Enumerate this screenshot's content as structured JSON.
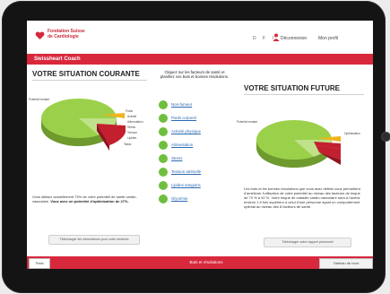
{
  "header": {
    "logo_lines": [
      "Fondation Suisse",
      "de Cardiologie"
    ],
    "lang_links": "D F I",
    "user_link": "Déconnexion",
    "profile_link": "Mon profil"
  },
  "brand_bar": {
    "title": "Swissheart Coach"
  },
  "left_panel": {
    "title": "VOTRE SITUATION COURANTE",
    "pie_labels": [
      "Potentiel restant",
      "Poids",
      "Activité",
      "Alimentation",
      "Stress",
      "Tension",
      "Lipides",
      "Tabac"
    ],
    "text": "Vous utilisez actuellement 73% de votre potentiel de santé cardio-vasculaire.",
    "text_bold": "Vous avez un potentiel d'optimisation de 27%.",
    "button": "Télécharger les informations pour votre médecin"
  },
  "middle_panel": {
    "intro": "Cliquez sur les facteurs de santé et planifiez vos buts et bonnes résolutions.",
    "factors": [
      {
        "label": "Non-fumeur",
        "color": "green"
      },
      {
        "label": "Poids corporel",
        "color": "green"
      },
      {
        "label": "Activité physique",
        "color": "green"
      },
      {
        "label": "Alimentation",
        "color": "green"
      },
      {
        "label": "Stress",
        "color": "green"
      },
      {
        "label": "Tension artérielle",
        "color": "green"
      },
      {
        "label": "Lipides sanguins",
        "color": "green"
      },
      {
        "label": "Glycémie",
        "color": "green"
      }
    ]
  },
  "right_panel": {
    "title": "VOTRE SITUATION FUTURE",
    "pie_labels": [
      "Potentiel restant",
      "Optimisation"
    ],
    "text": "Les buts et les bonnes résolutions que vous avez définis vous permettent d'améliorer l'utilisation de votre potentiel au niveau des facteurs de risque de 73 % à 92 %. Votre risque de maladie cardio-vasculaire sera à l'avenir environ 1.5 fois supérieur à celui d'une personne ayant un comportement optimal au niveau des 8 facteurs de santé.",
    "button": "Télécharger votre rapport personnel"
  },
  "footer": {
    "left_tab": "Tests",
    "center": "Buts et résolutions",
    "right_tab": "Tableau de bord"
  },
  "colors": {
    "accent": "#d8283c",
    "pie_green": "#8cc640",
    "pie_red": "#c41f2f",
    "pie_yellow": "#f2b21b"
  }
}
